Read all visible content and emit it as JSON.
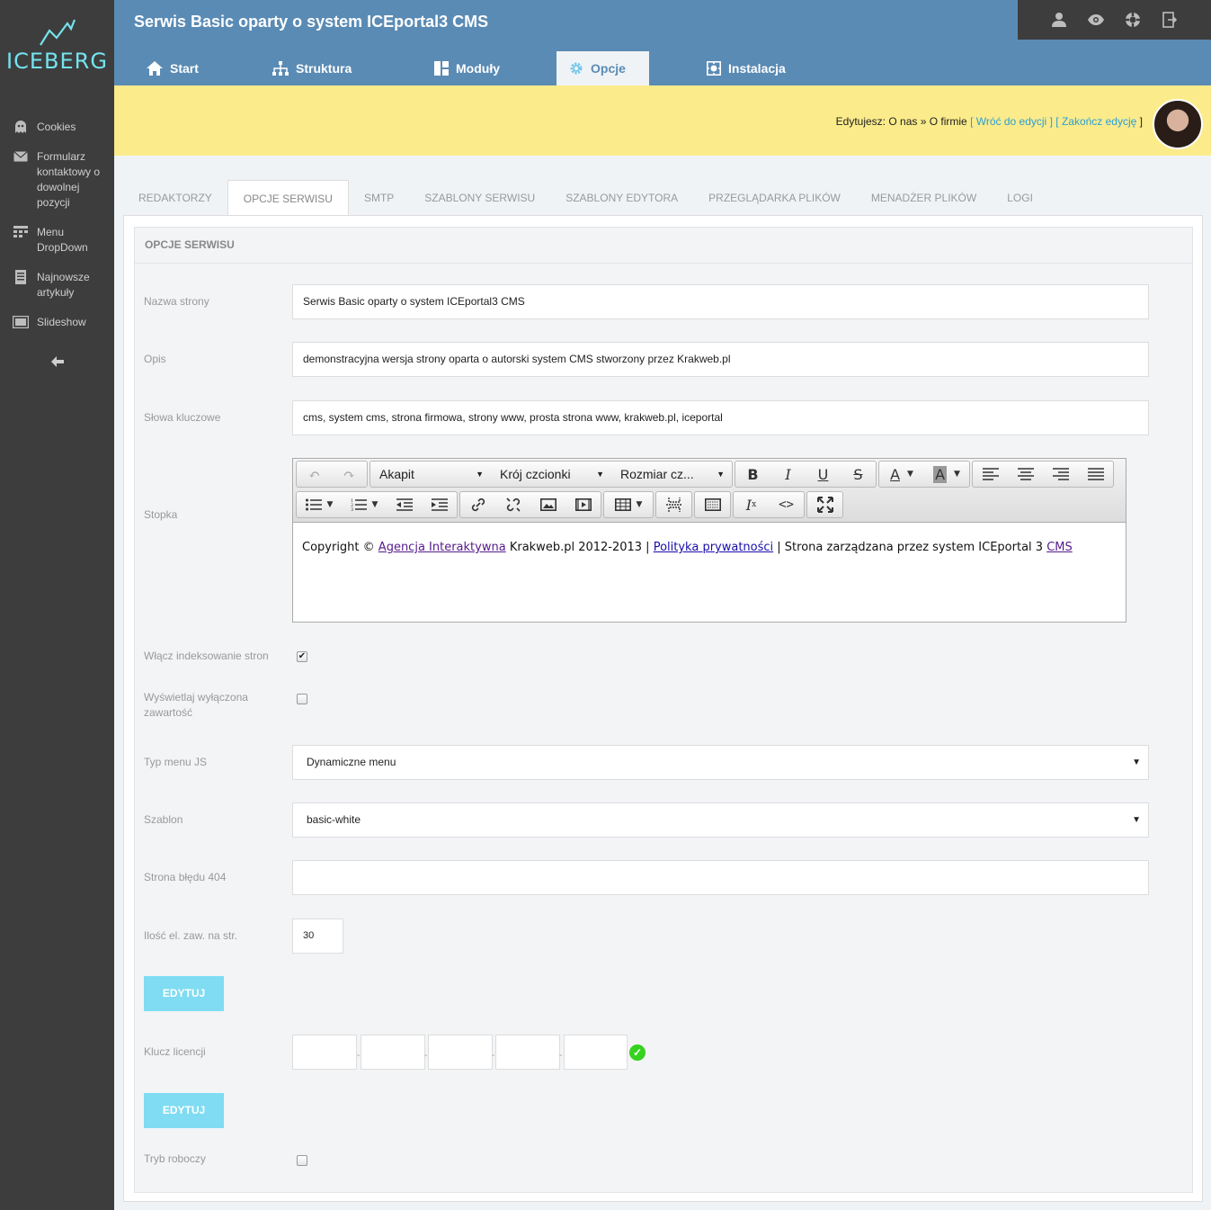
{
  "logo": {
    "text": "ICEBERG"
  },
  "sidebar": {
    "items": [
      {
        "label": "Cookies",
        "icon": "ghost-icon"
      },
      {
        "label": "Formularz kontaktowy o dowolnej pozycji",
        "icon": "envelope-icon"
      },
      {
        "label": "Menu DropDown",
        "icon": "menu-grid-icon"
      },
      {
        "label": "Najnowsze artykuły",
        "icon": "document-icon"
      },
      {
        "label": "Slideshow",
        "icon": "slideshow-icon"
      }
    ],
    "collapse_icon": "arrow-left-icon"
  },
  "header": {
    "title": "Serwis Basic oparty o system ICEportal3 CMS",
    "top_icons": [
      "user-icon",
      "eye-icon",
      "lifebuoy-icon",
      "logout-icon"
    ],
    "tabs": [
      {
        "label": "Start",
        "icon": "home-icon"
      },
      {
        "label": "Struktura",
        "icon": "sitemap-icon"
      },
      {
        "label": "Moduły",
        "icon": "modules-icon"
      },
      {
        "label": "Opcje",
        "icon": "gear-icon"
      },
      {
        "label": "Instalacja",
        "icon": "install-icon"
      }
    ]
  },
  "notice": {
    "prefix": "Edytujesz:",
    "path": "O nas » O firmie",
    "open1": "[",
    "back_link": "Wróć do edycji",
    "mid": "] [",
    "end_link": "Zakończ edycję",
    "close": "]"
  },
  "subtabs": [
    "REDAKTORZY",
    "OPCJE SERWISU",
    "SMTP",
    "SZABLONY SERWISU",
    "SZABLONY EDYTORA",
    "PRZEGLĄDARKA PLIKÓW",
    "MENADŻER PLIKÓW",
    "LOGI"
  ],
  "panel": {
    "title": "OPCJE SERWISU",
    "fields": {
      "site_name": {
        "label": "Nazwa strony",
        "value": "Serwis Basic oparty o system ICEportal3 CMS"
      },
      "description": {
        "label": "Opis",
        "value": "demonstracyjna wersja strony oparta o autorski system CMS stworzony przez Krakweb.pl"
      },
      "keywords": {
        "label": "Słowa kluczowe",
        "value": "cms, system cms, strona firmowa, strony www, prosta strona www, krakweb.pl, iceportal"
      },
      "footer": {
        "label": "Stopka"
      },
      "indexing": {
        "label": "Włącz indeksowanie stron",
        "checked": true
      },
      "show_disabled": {
        "label": "Wyświetlaj wyłączona zawartość",
        "checked": false
      },
      "menu_type": {
        "label": "Typ menu JS",
        "value": "Dynamiczne menu"
      },
      "template": {
        "label": "Szablon",
        "value": "basic-white"
      },
      "error404": {
        "label": "Strona błędu 404",
        "value": ""
      },
      "items_per_page": {
        "label": "Ilość el. zaw. na str.",
        "value": "30"
      },
      "license": {
        "label": "Klucz licencji"
      },
      "draft_mode": {
        "label": "Tryb roboczy",
        "checked": false
      }
    },
    "edit_button": "EDYTUJ"
  },
  "editor": {
    "format_dropdown": "Akapit",
    "font_dropdown": "Krój czcionki",
    "size_dropdown": "Rozmiar cz...",
    "content": {
      "t1": "Copyright © ",
      "link1": "Agencja Interaktywna",
      "t2": " Krakweb.pl 2012-2013 | ",
      "link2": "Polityka prywatności",
      "t3": " | Strona zarządzana przez system ICEportal 3 ",
      "link3": "CMS"
    }
  },
  "colors": {
    "sidebar_bg": "#3d3d3d",
    "header_bg": "#5a8bb4",
    "accent": "#74e3ee",
    "notice_bg": "#fbeb8b",
    "button_bg": "#7fdcf2",
    "link": "#2a9fd6"
  }
}
